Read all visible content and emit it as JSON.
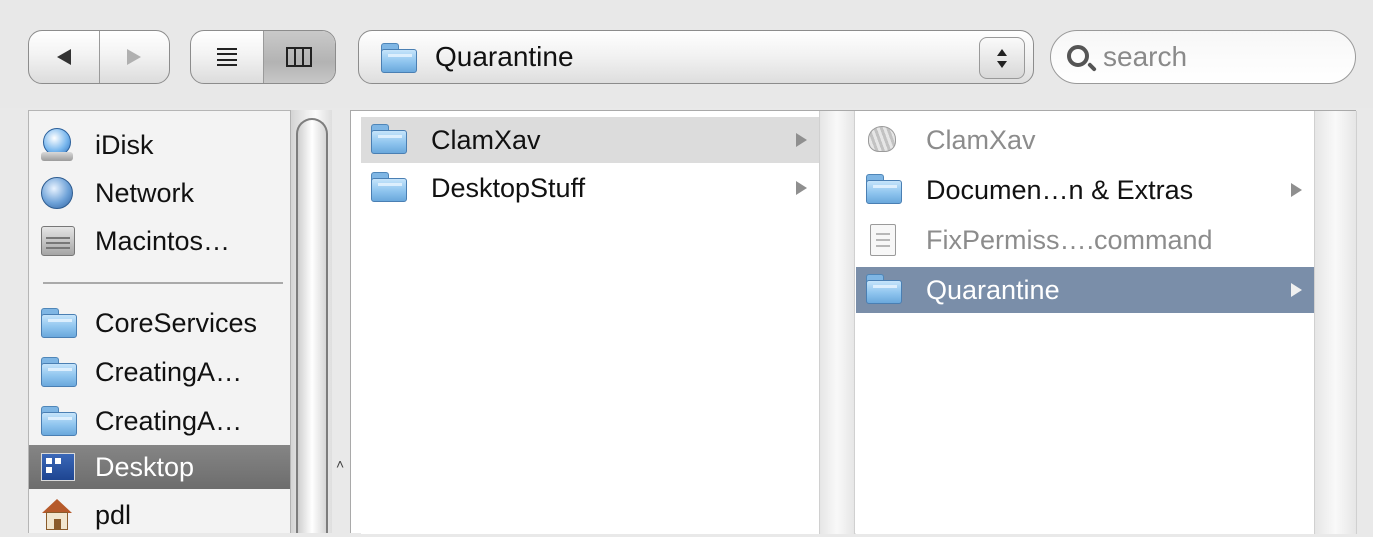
{
  "toolbar": {
    "path_popup_label": "Quarantine",
    "search_placeholder": "search"
  },
  "sidebar": {
    "devices": [
      {
        "label": "iDisk",
        "icon": "idisk-icon"
      },
      {
        "label": "Network",
        "icon": "network-icon"
      },
      {
        "label": "Macintos…",
        "icon": "hard-drive-icon"
      }
    ],
    "places": [
      {
        "label": "CoreServices",
        "icon": "folder-icon"
      },
      {
        "label": "CreatingA…",
        "icon": "folder-icon"
      },
      {
        "label": "CreatingA…",
        "icon": "folder-icon"
      },
      {
        "label": "Desktop",
        "icon": "desktop-icon",
        "selected": true
      },
      {
        "label": "pdl",
        "icon": "home-icon"
      }
    ]
  },
  "columns": [
    {
      "items": [
        {
          "label": "ClamXav",
          "icon": "folder-icon",
          "has_children": true,
          "state": "highlighted-inactive"
        },
        {
          "label": "DesktopStuff",
          "icon": "folder-icon",
          "has_children": true
        }
      ]
    },
    {
      "items": [
        {
          "label": "ClamXav",
          "icon": "clam-app-icon",
          "dimmed": true
        },
        {
          "label": "Documen…n & Extras",
          "icon": "folder-icon",
          "has_children": true
        },
        {
          "label": "FixPermiss….command",
          "icon": "document-icon",
          "dimmed": true
        },
        {
          "label": "Quarantine",
          "icon": "folder-icon",
          "has_children": true,
          "state": "selected"
        }
      ]
    }
  ],
  "colors": {
    "selection_blue": "#7a8ea9",
    "sidebar_selected": "#7a7a7a",
    "highlight_gray": "#dcdcdc"
  }
}
